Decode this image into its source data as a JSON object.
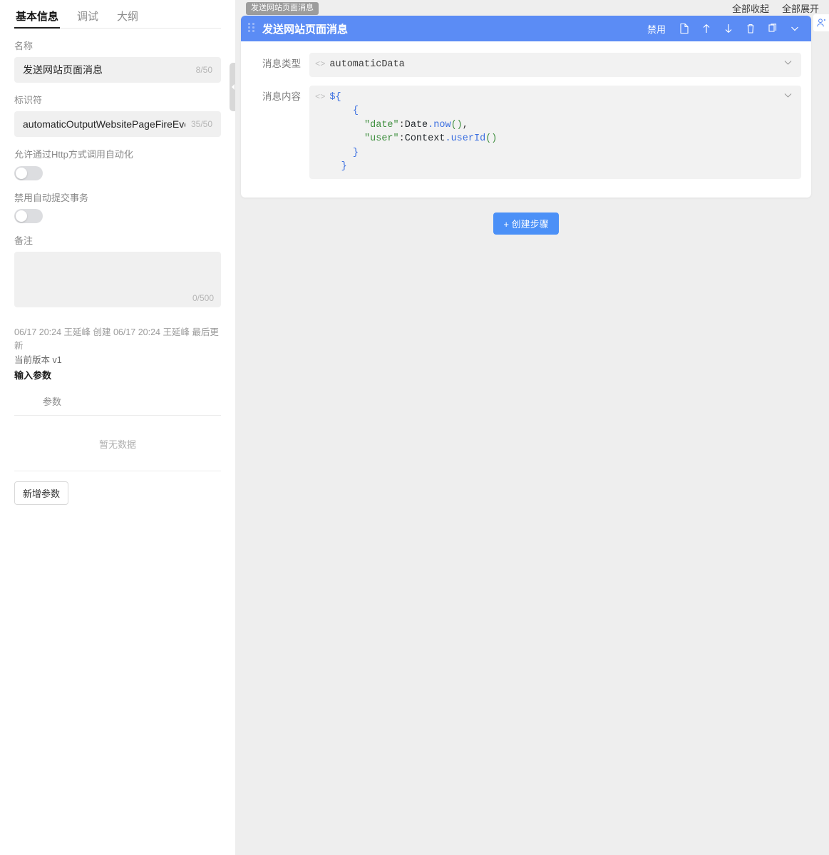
{
  "sidebar": {
    "tabs": [
      {
        "label": "基本信息",
        "active": true
      },
      {
        "label": "调试",
        "active": false
      },
      {
        "label": "大纲",
        "active": false
      }
    ],
    "name_field": {
      "label": "名称",
      "value": "发送网站页面消息",
      "counter": "8/50"
    },
    "identifier_field": {
      "label": "标识符",
      "value": "automaticOutputWebsitePageFireEvent",
      "counter": "35/50"
    },
    "http_switch": {
      "label": "允许通过Http方式调用自动化",
      "state": "off"
    },
    "transaction_switch": {
      "label": "禁用自动提交事务",
      "state": "off"
    },
    "remark_field": {
      "label": "备注",
      "value": "",
      "counter": "0/500"
    },
    "meta": {
      "audit": "06/17 20:24 王延峰 创建 06/17 20:24 王延峰 最后更新",
      "version": "当前版本 v1",
      "params_title": "输入参数"
    },
    "params_table": {
      "header": "参数",
      "empty_text": "暂无数据",
      "add_button": "新增参数"
    }
  },
  "main": {
    "top_links": [
      {
        "label": "全部收起"
      },
      {
        "label": "全部展开"
      }
    ],
    "node_tooltip": "发送网站页面消息",
    "card": {
      "title": "发送网站页面消息",
      "actions": {
        "disable_label": "禁用",
        "icons": [
          "document-icon",
          "arrow-up-icon",
          "arrow-down-icon",
          "trash-icon",
          "copy-icon",
          "chevron-down-icon"
        ]
      },
      "fields": [
        {
          "label": "消息类型",
          "icon": "code-icon",
          "value": "automaticData"
        },
        {
          "label": "消息内容",
          "icon": "code-icon",
          "value": "${\n    {\n      \"date\":Date.now(),\n      \"user\":Context.userId()\n    }\n  }"
        }
      ]
    },
    "add_step_button": "+ 创建步骤",
    "side_widget_icon": "user-icon"
  },
  "colors": {
    "header_blue": "#5b8cf5",
    "primary_blue": "#4b90f7",
    "page_bg": "#eeeeee",
    "input_bg": "#f0f0f0",
    "code_string": "#3f8f3f",
    "code_brace": "#3b6fe0"
  }
}
